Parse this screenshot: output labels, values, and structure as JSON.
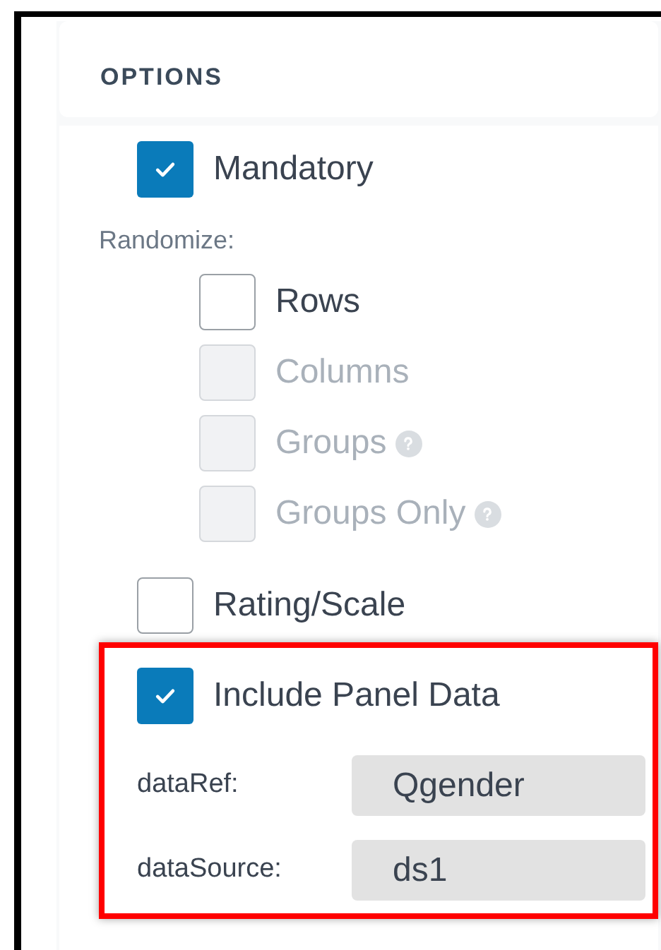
{
  "section_title": "OPTIONS",
  "mandatory": {
    "label": "Mandatory",
    "checked": true
  },
  "randomize": {
    "label": "Randomize:",
    "options": [
      {
        "label": "Rows",
        "checked": false,
        "disabled": false,
        "help": false
      },
      {
        "label": "Columns",
        "checked": false,
        "disabled": true,
        "help": false
      },
      {
        "label": "Groups",
        "checked": false,
        "disabled": true,
        "help": true
      },
      {
        "label": "Groups Only",
        "checked": false,
        "disabled": true,
        "help": true
      }
    ]
  },
  "rating_scale": {
    "label": "Rating/Scale",
    "checked": false
  },
  "panel_data": {
    "label": "Include Panel Data",
    "checked": true,
    "highlighted": true,
    "fields": [
      {
        "label": "dataRef:",
        "value": "Qgender"
      },
      {
        "label": "dataSource:",
        "value": "ds1"
      }
    ]
  }
}
